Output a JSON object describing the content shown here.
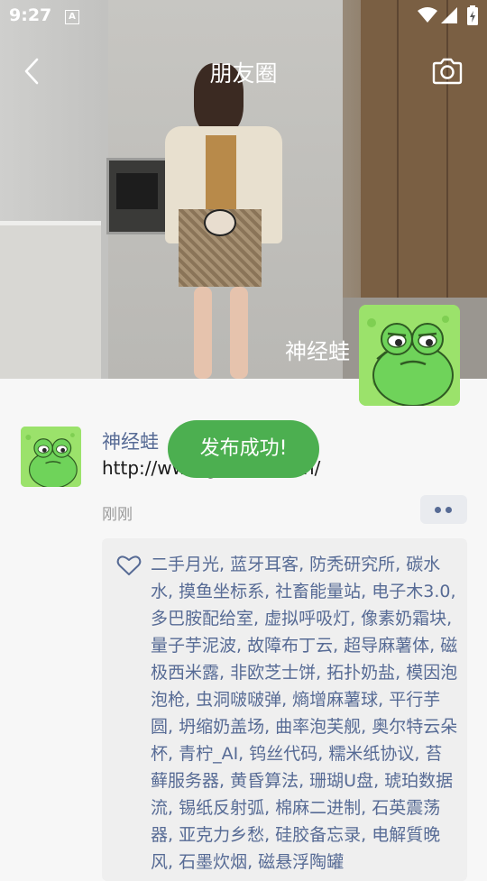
{
  "status_bar": {
    "time": "9:27",
    "ime_label": "A"
  },
  "nav": {
    "title": "朋友圈"
  },
  "cover": {
    "user_name": "神经蛙"
  },
  "post": {
    "user_name": "神经蛙",
    "content": "http://www.g...............n/",
    "time": "刚刚"
  },
  "toast": {
    "message": "发布成功!"
  },
  "likes": {
    "text": "二手月光, 蓝牙耳客, 防秃研究所, 碳水水, 摸鱼坐标系, 社畜能量站, 电子木3.0, 多巴胺配给室, 虚拟呼吸灯, 像素奶霜块, 量子芋泥波, 故障布丁云, 超导麻薯体, 磁极西米露, 非欧芝士饼, 拓扑奶盐, 模因泡泡枪, 虫洞啵啵弹, 熵增麻薯球, 平行芋圆, 坍缩奶盖场, 曲率泡芙舰, 奥尔特云朵杯, 青柠_AI, 钨丝代码, 糯米纸协议, 苔藓服务器, 黄昏算法, 珊瑚U盘, 琥珀数据流, 锡纸反射弧, 棉麻二进制, 石英震荡器, 亚克力乡愁, 硅胶备忘录, 电解質晚风, 石墨炊烟, 磁悬浮陶罐"
  },
  "icons": {
    "back": "chevron-left-icon",
    "camera": "camera-icon",
    "heart": "heart-outline-icon",
    "more": "more-dots-icon"
  },
  "colors": {
    "link_blue": "#576b95",
    "toast_green": "#4caf50",
    "avatar_green": "#9be26b"
  }
}
